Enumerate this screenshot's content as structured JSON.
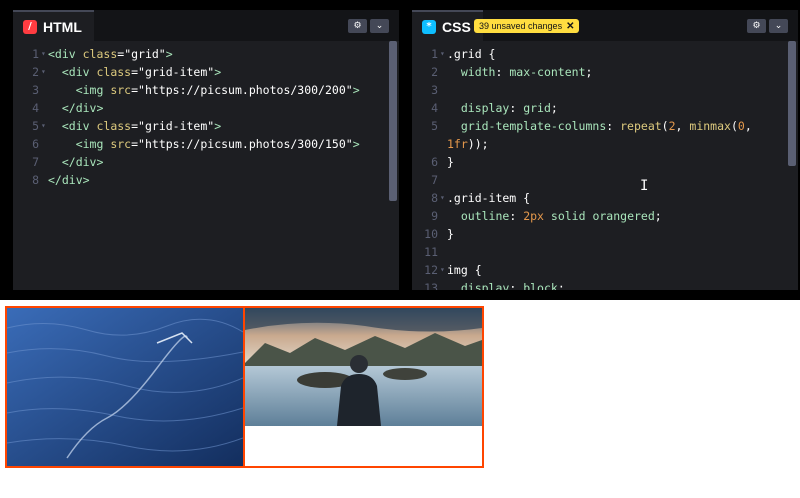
{
  "html_panel": {
    "title": "HTML",
    "icon": "html-icon",
    "lines": [
      {
        "n": "1",
        "fold": true,
        "parts": [
          [
            "t-tag",
            "<div "
          ],
          [
            "t-attr",
            "class"
          ],
          [
            "t-punc",
            "="
          ],
          [
            "t-str",
            "\"grid\""
          ],
          [
            "t-tag",
            ">"
          ]
        ]
      },
      {
        "n": "2",
        "fold": true,
        "parts": [
          [
            "t-punc",
            "  "
          ],
          [
            "t-tag",
            "<div "
          ],
          [
            "t-attr",
            "class"
          ],
          [
            "t-punc",
            "="
          ],
          [
            "t-str",
            "\"grid-item\""
          ],
          [
            "t-tag",
            ">"
          ]
        ]
      },
      {
        "n": "3",
        "fold": false,
        "parts": [
          [
            "t-punc",
            "    "
          ],
          [
            "t-tag",
            "<img "
          ],
          [
            "t-attr",
            "src"
          ],
          [
            "t-punc",
            "="
          ],
          [
            "t-str",
            "\"https://picsum.photos/300/200\""
          ],
          [
            "t-tag",
            ">"
          ]
        ]
      },
      {
        "n": "4",
        "fold": false,
        "parts": [
          [
            "t-punc",
            "  "
          ],
          [
            "t-tag",
            "</div>"
          ]
        ]
      },
      {
        "n": "5",
        "fold": true,
        "parts": [
          [
            "t-punc",
            "  "
          ],
          [
            "t-tag",
            "<div "
          ],
          [
            "t-attr",
            "class"
          ],
          [
            "t-punc",
            "="
          ],
          [
            "t-str",
            "\"grid-item\""
          ],
          [
            "t-tag",
            ">"
          ]
        ]
      },
      {
        "n": "6",
        "fold": false,
        "parts": [
          [
            "t-punc",
            "    "
          ],
          [
            "t-tag",
            "<img "
          ],
          [
            "t-attr",
            "src"
          ],
          [
            "t-punc",
            "="
          ],
          [
            "t-str",
            "\"https://picsum.photos/300/150\""
          ],
          [
            "t-tag",
            ">"
          ]
        ]
      },
      {
        "n": "7",
        "fold": false,
        "parts": [
          [
            "t-punc",
            "  "
          ],
          [
            "t-tag",
            "</div>"
          ]
        ]
      },
      {
        "n": "8",
        "fold": false,
        "parts": [
          [
            "t-tag",
            "</div>"
          ]
        ]
      }
    ]
  },
  "css_panel": {
    "title": "CSS",
    "icon": "css-icon",
    "unsaved_badge": "39 unsaved changes",
    "badge_close": "✕",
    "lines": [
      {
        "n": "1",
        "fold": true,
        "parts": [
          [
            "t-sel",
            ".grid "
          ],
          [
            "t-punc",
            "{"
          ]
        ]
      },
      {
        "n": "2",
        "fold": false,
        "parts": [
          [
            "t-punc",
            "  "
          ],
          [
            "t-prop",
            "width"
          ],
          [
            "t-punc",
            ": "
          ],
          [
            "t-val",
            "max-content"
          ],
          [
            "t-punc",
            ";"
          ]
        ]
      },
      {
        "n": "3",
        "fold": false,
        "parts": []
      },
      {
        "n": "4",
        "fold": false,
        "parts": [
          [
            "t-punc",
            "  "
          ],
          [
            "t-prop",
            "display"
          ],
          [
            "t-punc",
            ": "
          ],
          [
            "t-val",
            "grid"
          ],
          [
            "t-punc",
            ";"
          ]
        ]
      },
      {
        "n": "5",
        "fold": false,
        "parts": [
          [
            "t-punc",
            "  "
          ],
          [
            "t-prop",
            "grid-template-columns"
          ],
          [
            "t-punc",
            ": "
          ],
          [
            "t-fn",
            "repeat"
          ],
          [
            "t-punc",
            "("
          ],
          [
            "t-num",
            "2"
          ],
          [
            "t-punc",
            ", "
          ],
          [
            "t-fn",
            "minmax"
          ],
          [
            "t-punc",
            "("
          ],
          [
            "t-num",
            "0"
          ],
          [
            "t-punc",
            ","
          ]
        ]
      },
      {
        "n": "",
        "fold": false,
        "parts": [
          [
            "t-num",
            "1fr"
          ],
          [
            "t-punc",
            "));"
          ]
        ]
      },
      {
        "n": "6",
        "fold": false,
        "parts": [
          [
            "t-punc",
            "}"
          ]
        ]
      },
      {
        "n": "7",
        "fold": false,
        "parts": []
      },
      {
        "n": "8",
        "fold": true,
        "parts": [
          [
            "t-sel",
            ".grid-item "
          ],
          [
            "t-punc",
            "{"
          ]
        ]
      },
      {
        "n": "9",
        "fold": false,
        "parts": [
          [
            "t-punc",
            "  "
          ],
          [
            "t-prop",
            "outline"
          ],
          [
            "t-punc",
            ": "
          ],
          [
            "t-num",
            "2px"
          ],
          [
            "t-punc",
            " "
          ],
          [
            "t-val",
            "solid orangered"
          ],
          [
            "t-punc",
            ";"
          ]
        ]
      },
      {
        "n": "10",
        "fold": false,
        "parts": [
          [
            "t-punc",
            "}"
          ]
        ]
      },
      {
        "n": "11",
        "fold": false,
        "parts": []
      },
      {
        "n": "12",
        "fold": true,
        "parts": [
          [
            "t-sel",
            "img "
          ],
          [
            "t-punc",
            "{"
          ]
        ]
      },
      {
        "n": "13",
        "fold": false,
        "parts": [
          [
            "t-punc",
            "  "
          ],
          [
            "t-prop",
            "display"
          ],
          [
            "t-punc",
            ": "
          ],
          [
            "t-val",
            "block"
          ],
          [
            "t-punc",
            ";"
          ]
        ]
      }
    ]
  },
  "header_buttons": {
    "settings_icon": "gear-icon",
    "settings_glyph": "⚙",
    "collapse_icon": "chevron-down-icon",
    "collapse_glyph": "⌄"
  },
  "cursor_glyph": "I",
  "colors": {
    "outline": "#ff4500",
    "badge": "#ffdd40",
    "html_icon": "#ff3c41",
    "css_icon": "#0ebeff"
  }
}
